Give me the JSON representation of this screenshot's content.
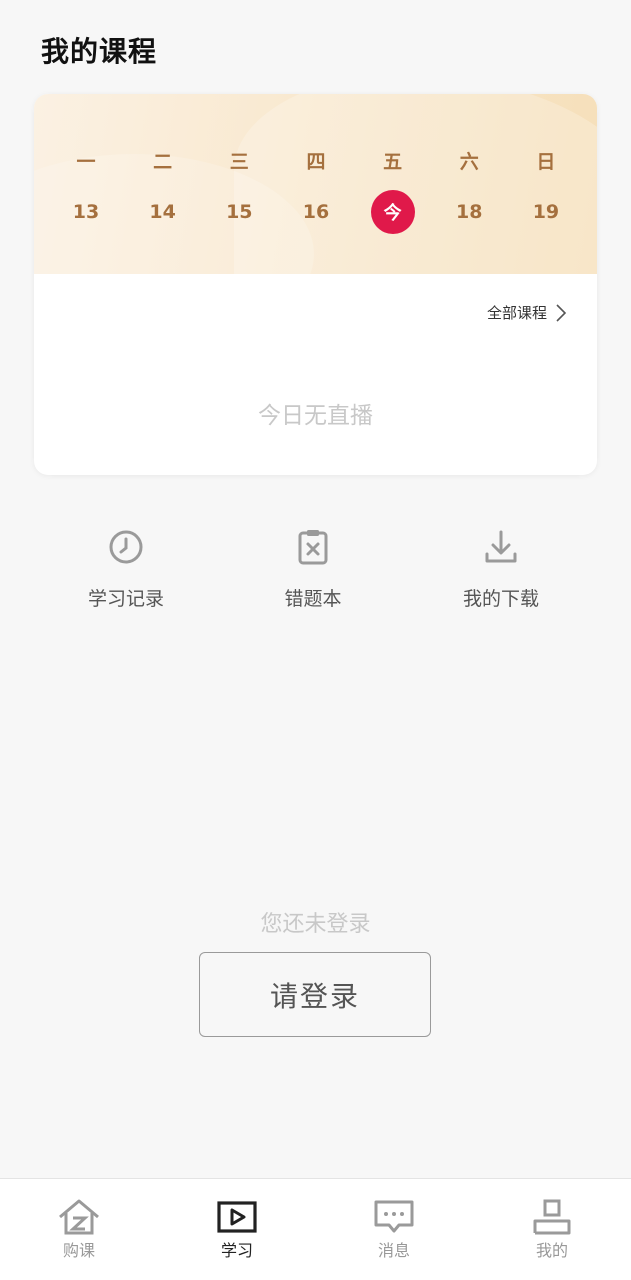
{
  "header": {
    "title": "我的课程"
  },
  "calendar": {
    "weekdays": [
      "一",
      "二",
      "三",
      "四",
      "五",
      "六",
      "日"
    ],
    "dates": [
      "13",
      "14",
      "15",
      "16",
      "今",
      "18",
      "19"
    ],
    "today_index": 4,
    "today_color": "#e0194a",
    "text_color": "#a5703e"
  },
  "course_card": {
    "all_courses_link": "全部课程",
    "empty_text": "今日无直播"
  },
  "shortcuts": [
    {
      "label": "学习记录",
      "icon": "clock-icon"
    },
    {
      "label": "错题本",
      "icon": "clipboard-x-icon"
    },
    {
      "label": "我的下载",
      "icon": "download-icon"
    }
  ],
  "login": {
    "hint": "您还未登录",
    "button_label": "请登录"
  },
  "tabbar": {
    "tabs": [
      {
        "label": "购课",
        "icon": "home-icon",
        "active": false
      },
      {
        "label": "学习",
        "icon": "play-icon",
        "active": true
      },
      {
        "label": "消息",
        "icon": "message-icon",
        "active": false
      },
      {
        "label": "我的",
        "icon": "user-icon",
        "active": false
      }
    ]
  }
}
